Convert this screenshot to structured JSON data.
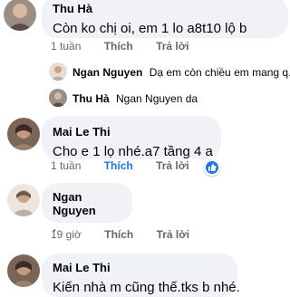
{
  "comments": [
    {
      "author": "Thu Hà",
      "text": "Còn ko  chị  oi, em 1 lo a8t10 lộ b",
      "time": "1 tuần",
      "like": "Thích",
      "reply": "Trả lời"
    },
    {
      "author": "Mai Le Thi",
      "text": "Cho e 1 lọ nhé.a7 tầng 4 a",
      "time": "1 tuần",
      "like": "Thích",
      "reply": "Trả lời",
      "reaction_icon": "like-icon"
    },
    {
      "author": "Ngan Nguyen",
      "text": ".",
      "time": "19 giờ",
      "like": "Thích",
      "reply": "Trả lời"
    },
    {
      "author": "Mai Le Thi",
      "text": "Kiến nhà m cũng thế.tks b nhé."
    }
  ],
  "replies": [
    {
      "author": "Ngan Nguyen",
      "text": "Dạ em còn chiều em mang q..."
    },
    {
      "author": "Thu Hà",
      "text": "Ngan Nguyen da"
    }
  ],
  "colors": {
    "link_blue": "#1877f2",
    "bubble_bg": "#f0f2f5",
    "meta_gray": "#65676b"
  }
}
